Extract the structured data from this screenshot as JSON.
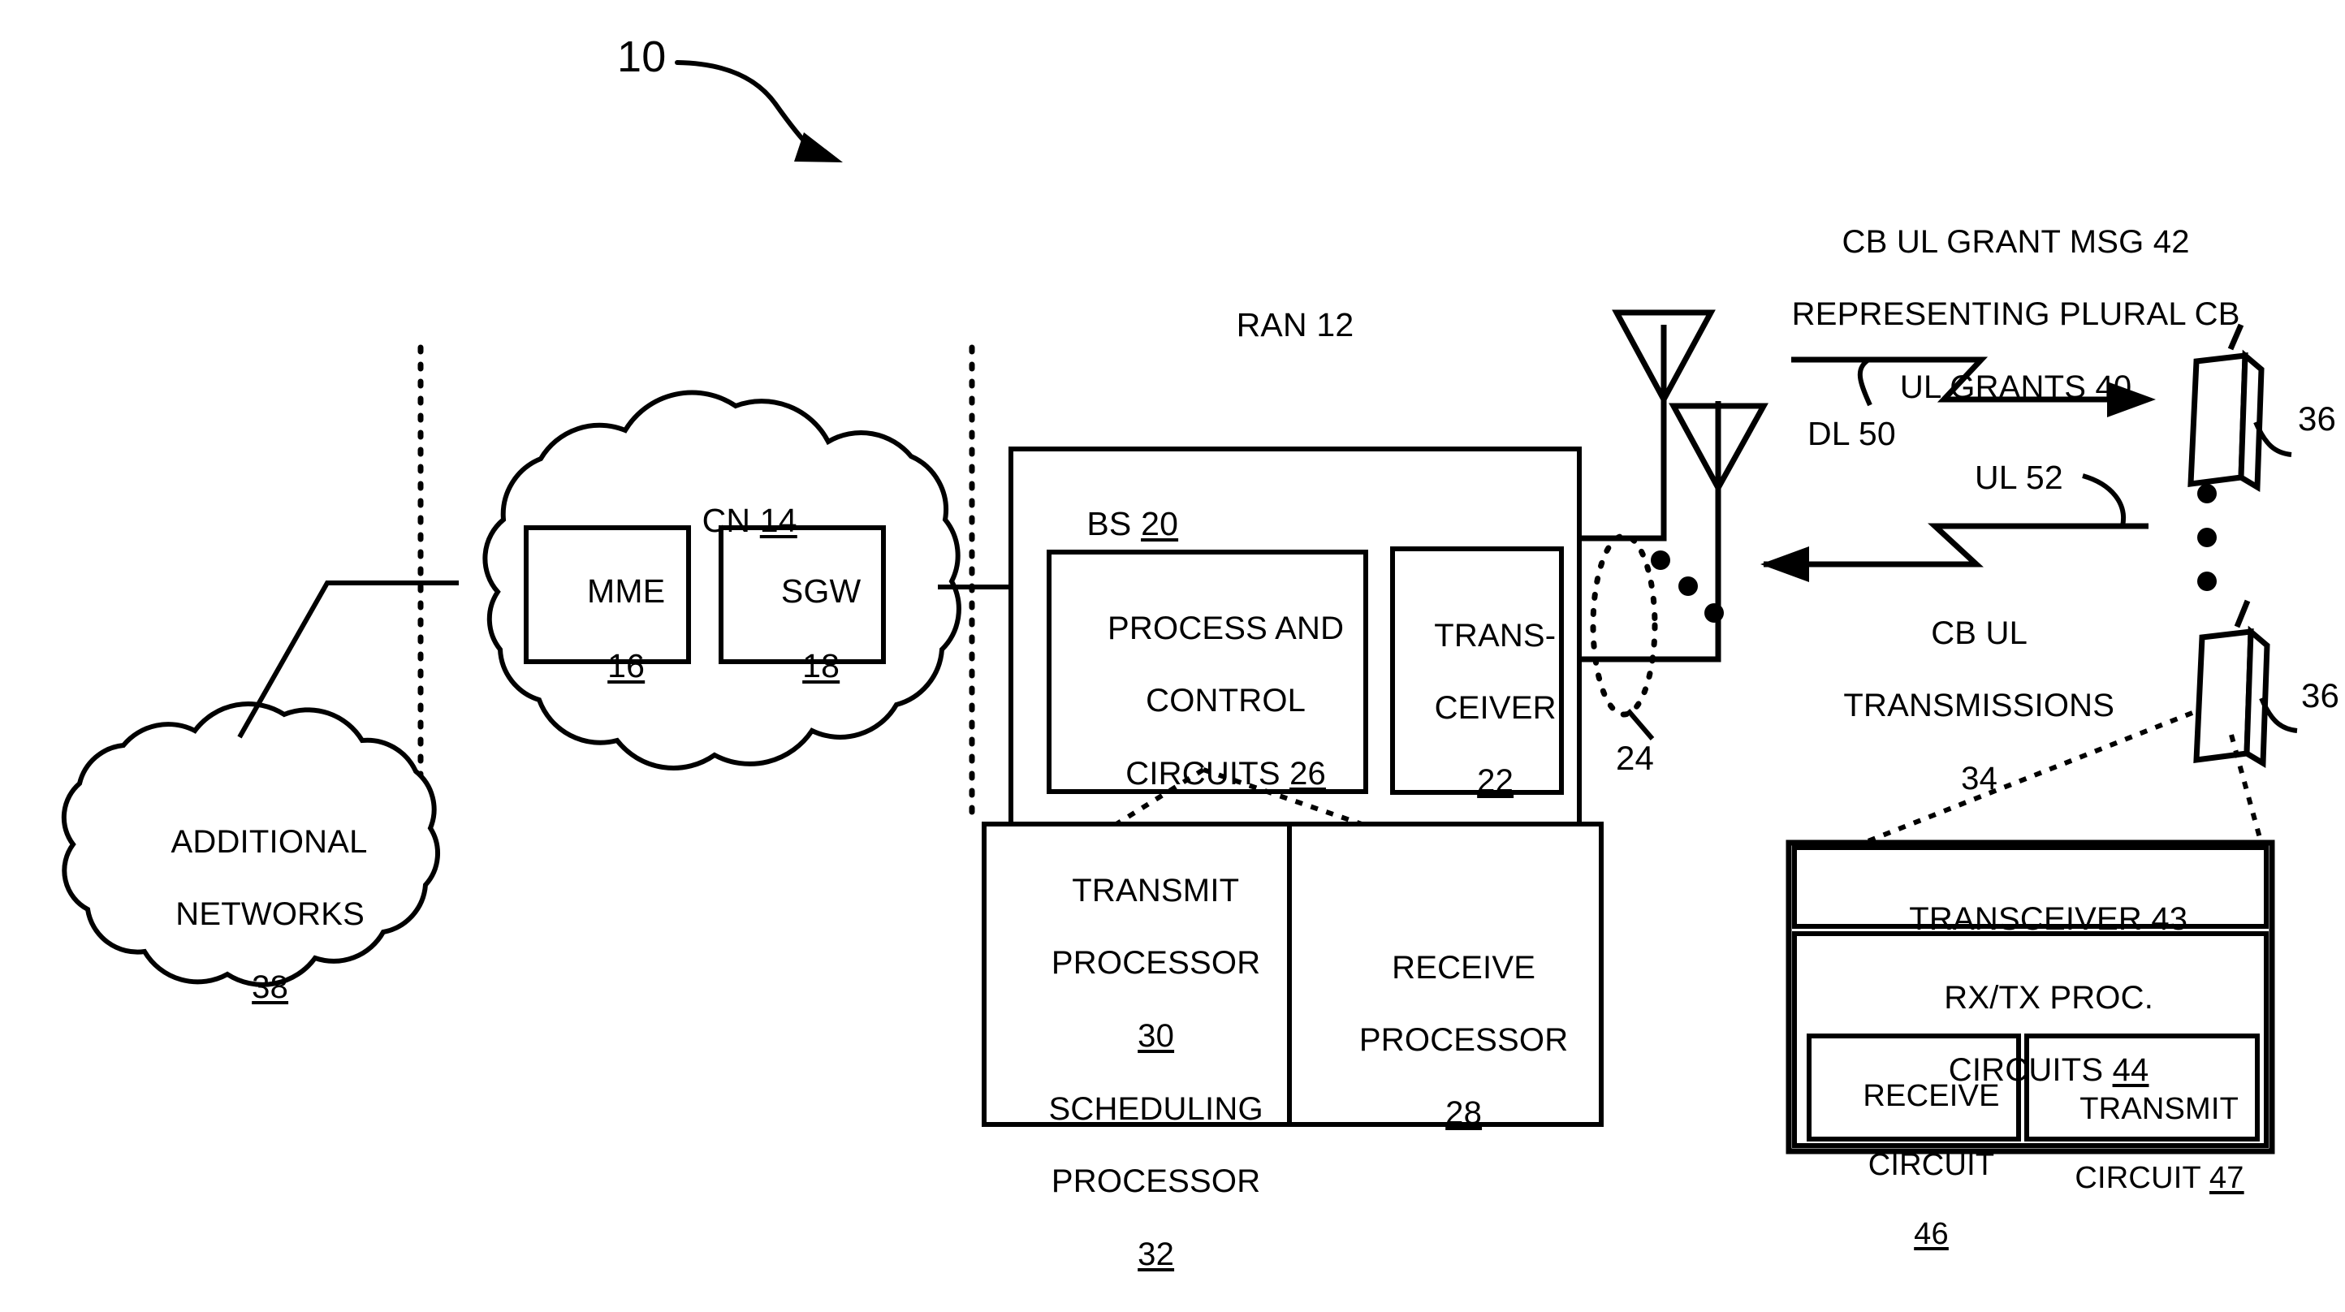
{
  "figure": {
    "number": "10",
    "ran_label": "RAN 12"
  },
  "core_network": {
    "title_text": "CN ",
    "title_num": "14",
    "nodes": [
      {
        "name": "MME",
        "num": "16"
      },
      {
        "name": "SGW",
        "num": "18"
      }
    ]
  },
  "additional_networks": {
    "line1": "ADDITIONAL",
    "line2": "NETWORKS",
    "num": "38"
  },
  "base_station": {
    "label_text": "BS ",
    "label_num": "20",
    "process_control": {
      "line1": "PROCESS AND",
      "line2": "CONTROL",
      "line3": "CIRCUITS ",
      "num": "26"
    },
    "transceiver": {
      "line1": "TRANS-",
      "line2": "CEIVER",
      "num": "22"
    },
    "antenna_group_num": "24"
  },
  "bs_detail": {
    "transmit_processor": {
      "line1": "TRANSMIT",
      "line2": "PROCESSOR",
      "num1": "30",
      "line3": "SCHEDULING",
      "line4": "PROCESSOR",
      "num2": "32"
    },
    "receive_processor": {
      "line1": "RECEIVE",
      "line2": "PROCESSOR",
      "num": "28"
    }
  },
  "air_interface": {
    "grant_msg": {
      "line1": "CB UL GRANT MSG 42",
      "line2": "REPRESENTING PLURAL CB",
      "line3": "UL GRANTS 40"
    },
    "downlink_label": "DL 50",
    "uplink_label": "UL 52",
    "cb_ul_transmissions": {
      "line1": "CB UL",
      "line2": "TRANSMISSIONS",
      "num": "34"
    }
  },
  "user_equipment": {
    "num_top": "36",
    "num_bottom": "36",
    "detail": {
      "transceiver_text": "TRANSCEIVER ",
      "transceiver_num": "43",
      "rxtx_line1": "RX/TX PROC.",
      "rxtx_line2": "CIRCUITS ",
      "rxtx_num": "44",
      "receive_circuit": {
        "line1": "RECEIVE",
        "line2": "CIRCUIT",
        "num": "46"
      },
      "transmit_circuit": {
        "line1": "TRANSMIT",
        "line2": "CIRCUIT ",
        "num": "47"
      }
    }
  },
  "colors": {
    "ink": "#000000",
    "paper": "#ffffff"
  }
}
